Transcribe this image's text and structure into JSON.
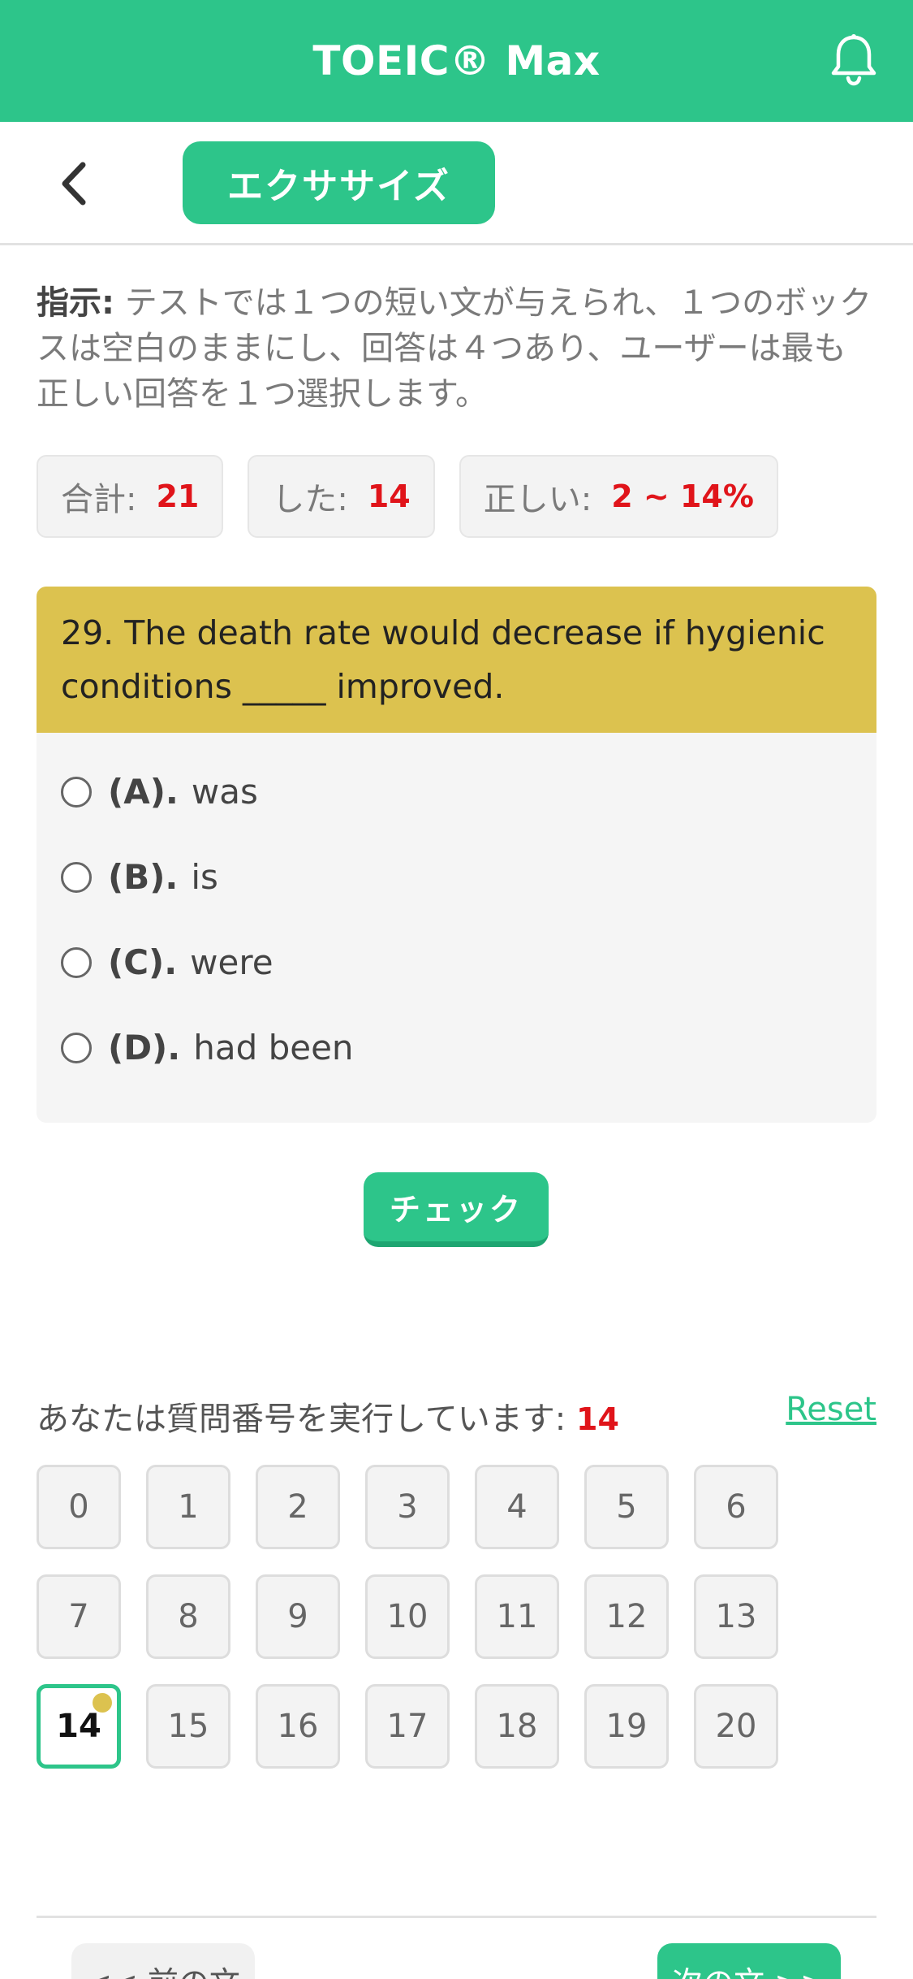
{
  "header": {
    "title": "TOEIC® Max",
    "notification_icon": "bell-icon"
  },
  "nav": {
    "back_icon": "chevron-left-icon",
    "tab_label": "エクササイズ"
  },
  "instructions": {
    "label": "指示:",
    "text": " テストでは１つの短い文が与えられ、１つのボックスは空白のままにし、回答は４つあり、ユーザーは最も正しい回答を１つ選択します。"
  },
  "stats": {
    "total_label": "合計:",
    "total_value": "21",
    "done_label": "した:",
    "done_value": "14",
    "correct_label": "正しい:",
    "correct_value": "2 ~ 14%"
  },
  "question": {
    "text": "29. The death rate would decrease if hygienic conditions _____ improved.",
    "options": [
      {
        "letter": "(A).",
        "text": "was"
      },
      {
        "letter": "(B).",
        "text": "is"
      },
      {
        "letter": "(C).",
        "text": "were"
      },
      {
        "letter": "(D).",
        "text": "had been"
      }
    ]
  },
  "check_label": "チェック",
  "progress": {
    "label": "あなたは質問番号を実行しています:",
    "current": "14",
    "reset_label": "Reset",
    "numbers": [
      "0",
      "1",
      "2",
      "3",
      "4",
      "5",
      "6",
      "7",
      "8",
      "9",
      "10",
      "11",
      "12",
      "13",
      "14",
      "15",
      "16",
      "17",
      "18",
      "19",
      "20"
    ]
  },
  "footer": {
    "prev_label": "<< 前の文",
    "next_label": "次の文 >>"
  },
  "colors": {
    "accent": "#2dc58a",
    "question_header": "#dcc24f",
    "highlight_number": "#e0141a"
  }
}
